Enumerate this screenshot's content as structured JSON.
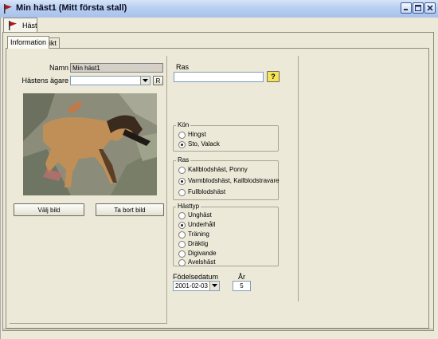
{
  "window": {
    "title": "Min häst1  (Mitt första stall)"
  },
  "document_tab": {
    "label": "Häst"
  },
  "tabs": [
    {
      "label": "Information",
      "active": true
    },
    {
      "label": "Vikt",
      "active": false
    }
  ],
  "form": {
    "name_label": "Namn",
    "name_value": "Min häst1",
    "owner_label": "Hästens ägare",
    "owner_value": "",
    "owner_button": "R",
    "choose_image": "Välj bild",
    "remove_image": "Ta bort bild"
  },
  "breed": {
    "label": "Ras",
    "value": "",
    "help_button": "?"
  },
  "gender_group": {
    "title": "Kön",
    "options": [
      {
        "label": "Hingst",
        "checked": false
      },
      {
        "label": "Sto, Valack",
        "checked": true
      }
    ]
  },
  "breed_group": {
    "title": "Ras",
    "options": [
      {
        "label": "Kallblodshäst, Ponny",
        "checked": false
      },
      {
        "label": "Varmblodshäst, Kallblodstravare",
        "checked": true
      },
      {
        "label": "Fullblodshäst",
        "checked": false
      }
    ]
  },
  "horsetype_group": {
    "title": "Hästtyp",
    "options": [
      {
        "label": "Unghäst",
        "checked": false
      },
      {
        "label": "Underhåll",
        "checked": true
      },
      {
        "label": "Träning",
        "checked": false
      },
      {
        "label": "Dräktig",
        "checked": false
      },
      {
        "label": "Digivande",
        "checked": false
      },
      {
        "label": "Avelshäst",
        "checked": false
      }
    ]
  },
  "birth": {
    "date_label": "Födelsedatum",
    "date_value": "2001-02-03",
    "age_label": "År",
    "age_value": "5"
  },
  "colors": {
    "titlebar": "#b8cff0",
    "background": "#ECE9D8",
    "help_button": "#f5e35a"
  }
}
